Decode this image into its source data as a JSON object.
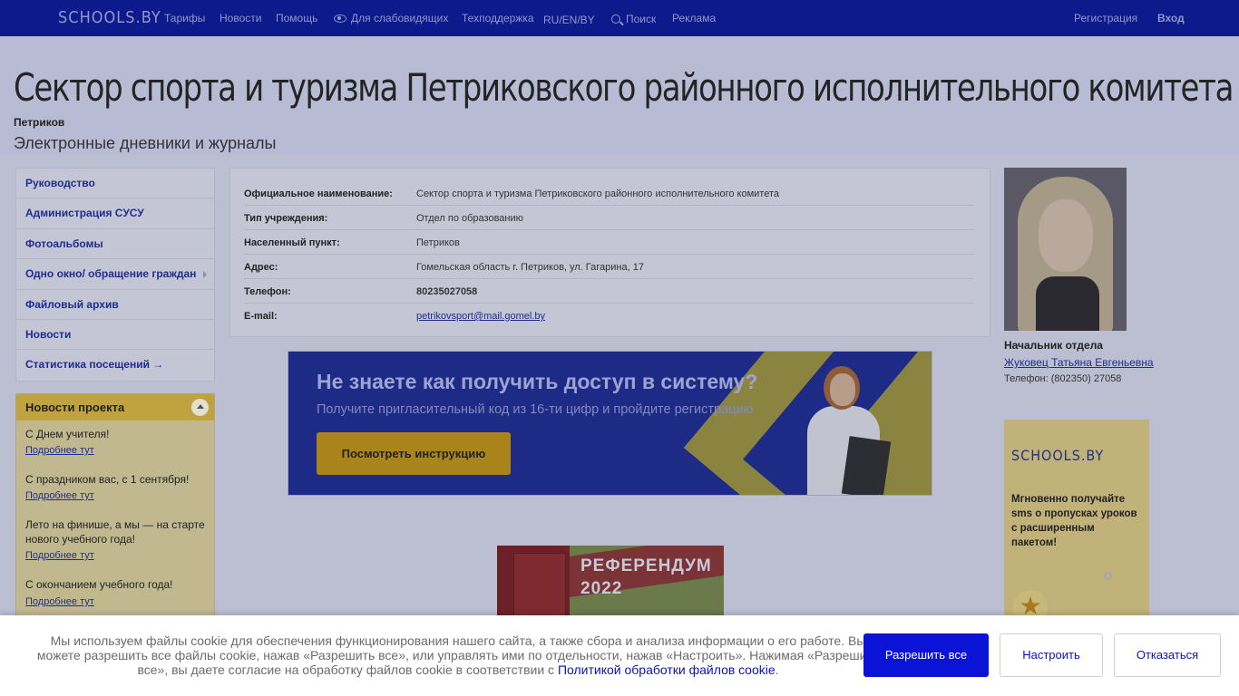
{
  "topbar": {
    "logo": "SCHOOLS.BY",
    "nav": [
      "Тарифы",
      "Новости",
      "Помощь",
      "Для слабовидящих",
      "Техподдержка",
      "RU/EN/BY",
      "Поиск",
      "Реклама"
    ],
    "register": "Регистрация",
    "login": "Вход"
  },
  "header": {
    "title": "Сектор спорта и туризма Петриковского районного исполнительного комитета",
    "city": "Петриков",
    "subtitle": "Электронные дневники и журналы"
  },
  "menu": [
    "Руководство",
    "Администрация СУСУ",
    "Фотоальбомы",
    "Одно окно/ обращение граждан",
    "Файловый архив",
    "Новости",
    "Статистика посещений →"
  ],
  "news": {
    "title": "Новости проекта",
    "items": [
      {
        "text": "С Днем учителя!",
        "more": "Подробнее тут"
      },
      {
        "text": "С праздником вас, с 1 сентября!",
        "more": "Подробнее тут"
      },
      {
        "text": "Лето на финише, а мы — на старте нового учебного года!",
        "more": "Подробнее тут"
      },
      {
        "text": "С окончанием учебного года!",
        "more": "Подробнее тут"
      }
    ]
  },
  "info": [
    {
      "k": "Официальное наименование:",
      "v": "Сектор спорта и туризма Петриковского районного исполнительного комитета"
    },
    {
      "k": "Тип учреждения:",
      "v": "Отдел по образованию"
    },
    {
      "k": "Населенный пункт:",
      "v": "Петриков"
    },
    {
      "k": "Адрес:",
      "v": "Гомельская область г. Петриков, ул. Гагарина, 17"
    },
    {
      "k": "Телефон:",
      "v": "80235027058"
    },
    {
      "k": "E-mail:",
      "v": "petrikovsport@mail.gomel.by"
    }
  ],
  "banner": {
    "title": "Не знаете как получить доступ в систему?",
    "text": "Получите пригласительный код из 16-ти цифр и пройдите регистрацию",
    "button": "Посмотреть инструкцию"
  },
  "referendum": {
    "line1": "РЕФЕРЕНДУМ",
    "line2": "2022"
  },
  "head": {
    "role": "Начальник отдела",
    "name": "Жуковец Татьяна Евгеньевна",
    "phone": "Телефон: (802350) 27058"
  },
  "ad": {
    "logo": "SCHOOLS.BY",
    "text": "Мгновенно получайте sms о пропусках уроков с расширенным пакетом!"
  },
  "cookie": {
    "text": "Мы используем файлы cookie для обеспечения функционирования нашего сайта, а также сбора и анализа информации о его работе. Вы можете разрешить все файлы cookie, нажав «Разрешить все», или управлять ими по отдельности, нажав «Настроить». Нажимая «Разрешить все», вы даете согласие на обработку файлов cookie в соответствии с ",
    "link": "Политикой обработки файлов cookie",
    "end": ".",
    "allow": "Разрешить все",
    "configure": "Настроить",
    "deny": "Отказаться"
  }
}
